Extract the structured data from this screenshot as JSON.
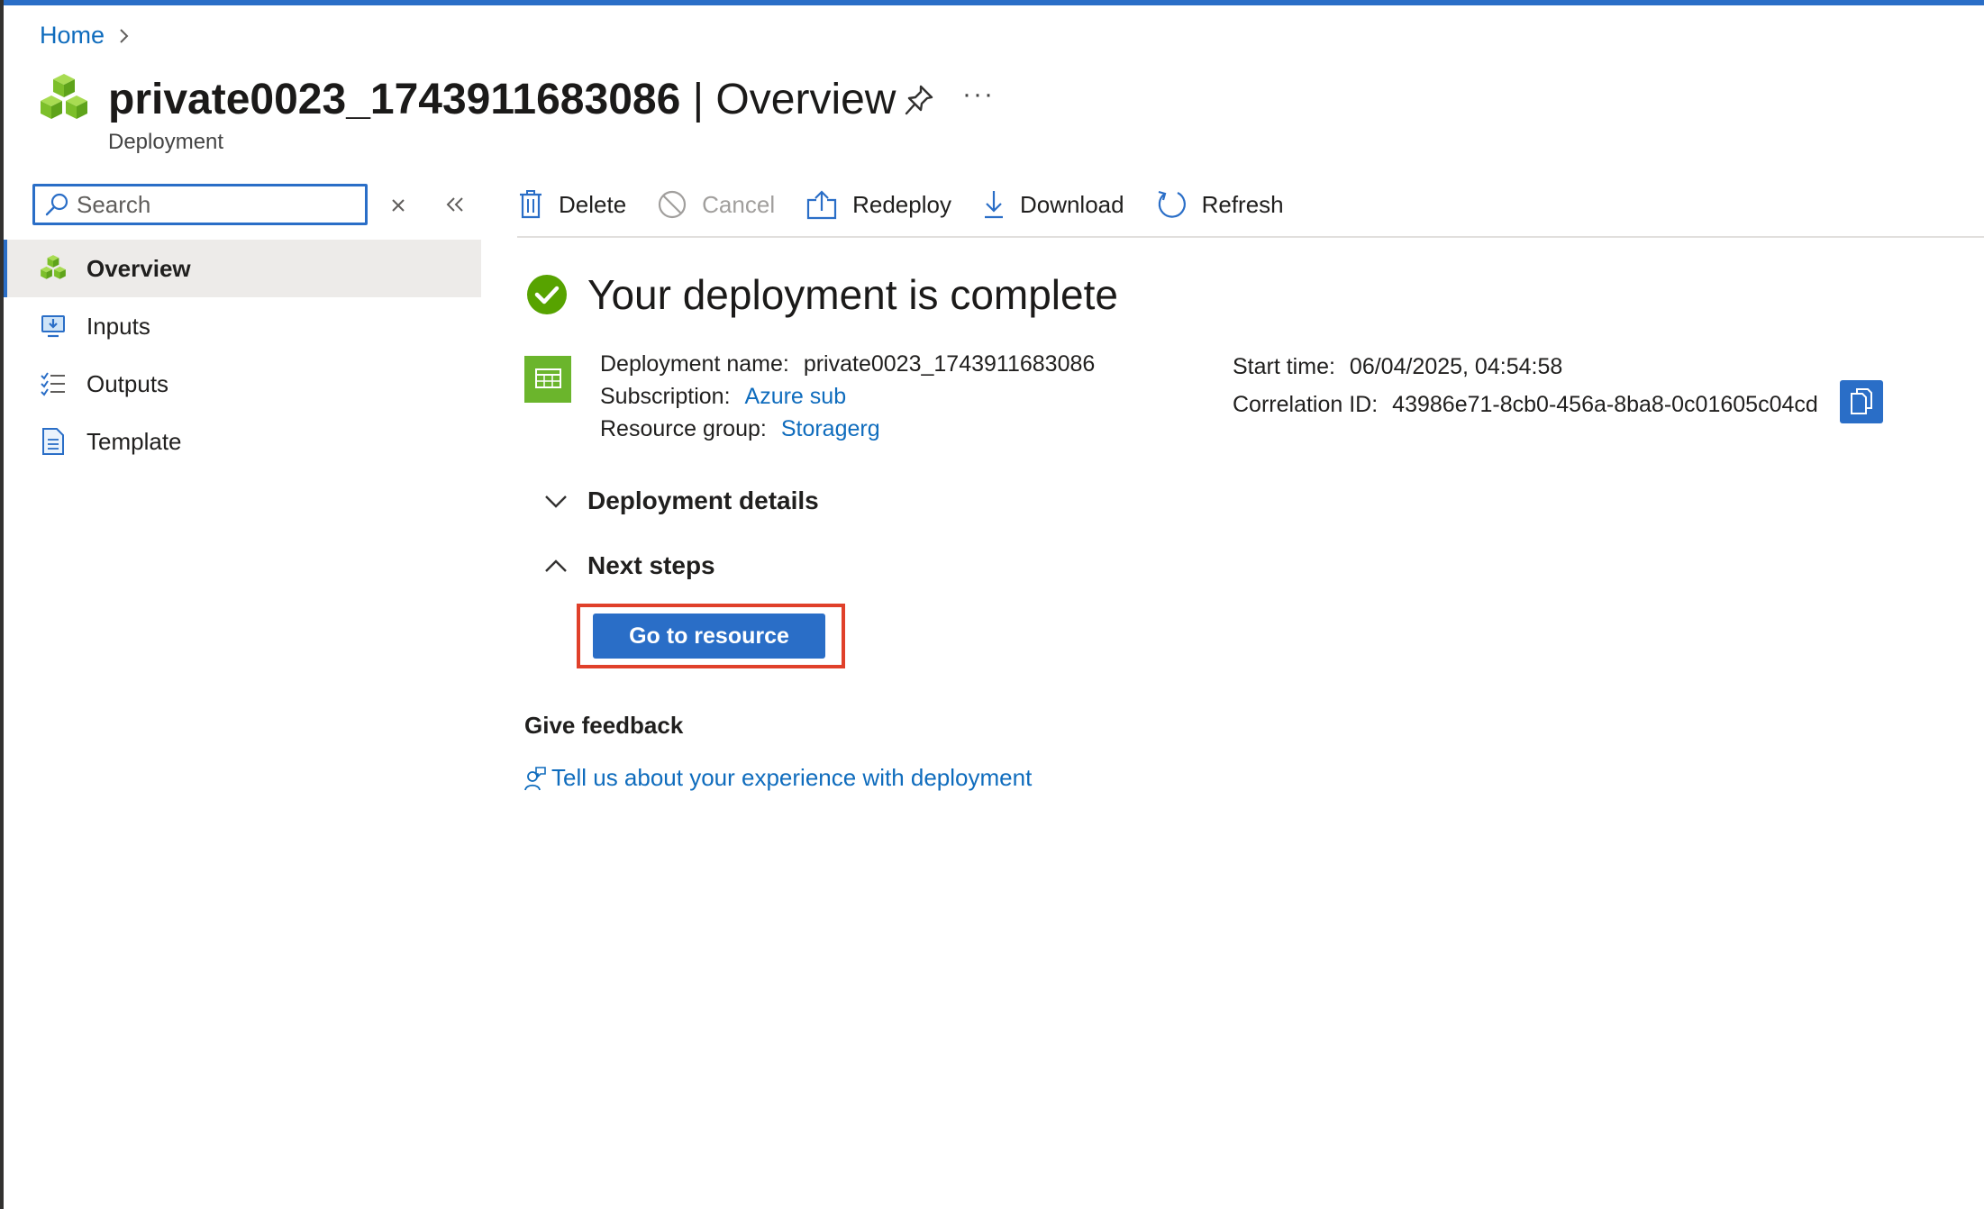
{
  "colors": {
    "accent": "#2a6ec7",
    "link": "#0f6cbd",
    "success": "#57a300",
    "highlight_border": "#e0402a"
  },
  "breadcrumb": {
    "home": "Home"
  },
  "header": {
    "title": "private0023_1743911683086",
    "title_suffix": " | Overview",
    "subtitle": "Deployment",
    "more": "···"
  },
  "search": {
    "placeholder": "Search",
    "value": ""
  },
  "sidebar": {
    "items": [
      {
        "label": "Overview",
        "icon": "deployment-cubes-icon",
        "active": true
      },
      {
        "label": "Inputs",
        "icon": "inputs-icon"
      },
      {
        "label": "Outputs",
        "icon": "outputs-list-icon"
      },
      {
        "label": "Template",
        "icon": "template-document-icon"
      }
    ]
  },
  "toolbar": {
    "delete": "Delete",
    "cancel": "Cancel",
    "redeploy": "Redeploy",
    "download": "Download",
    "refresh": "Refresh"
  },
  "status": {
    "message": "Your deployment is complete",
    "icon": "check-circle-icon"
  },
  "details": {
    "deployment_name_label": "Deployment name:",
    "deployment_name": "private0023_1743911683086",
    "subscription_label": "Subscription:",
    "subscription": "Azure sub",
    "resource_group_label": "Resource group:",
    "resource_group": "Storagerg",
    "start_time_label": "Start time:",
    "start_time": "06/04/2025, 04:54:58",
    "correlation_id_label": "Correlation ID:",
    "correlation_id": "43986e71-8cb0-456a-8ba8-0c01605c04cd"
  },
  "sections": {
    "deployment_details": "Deployment details",
    "next_steps": "Next steps"
  },
  "actions": {
    "go_to_resource": "Go to resource"
  },
  "feedback": {
    "heading": "Give feedback",
    "link": "Tell us about your experience with deployment"
  }
}
